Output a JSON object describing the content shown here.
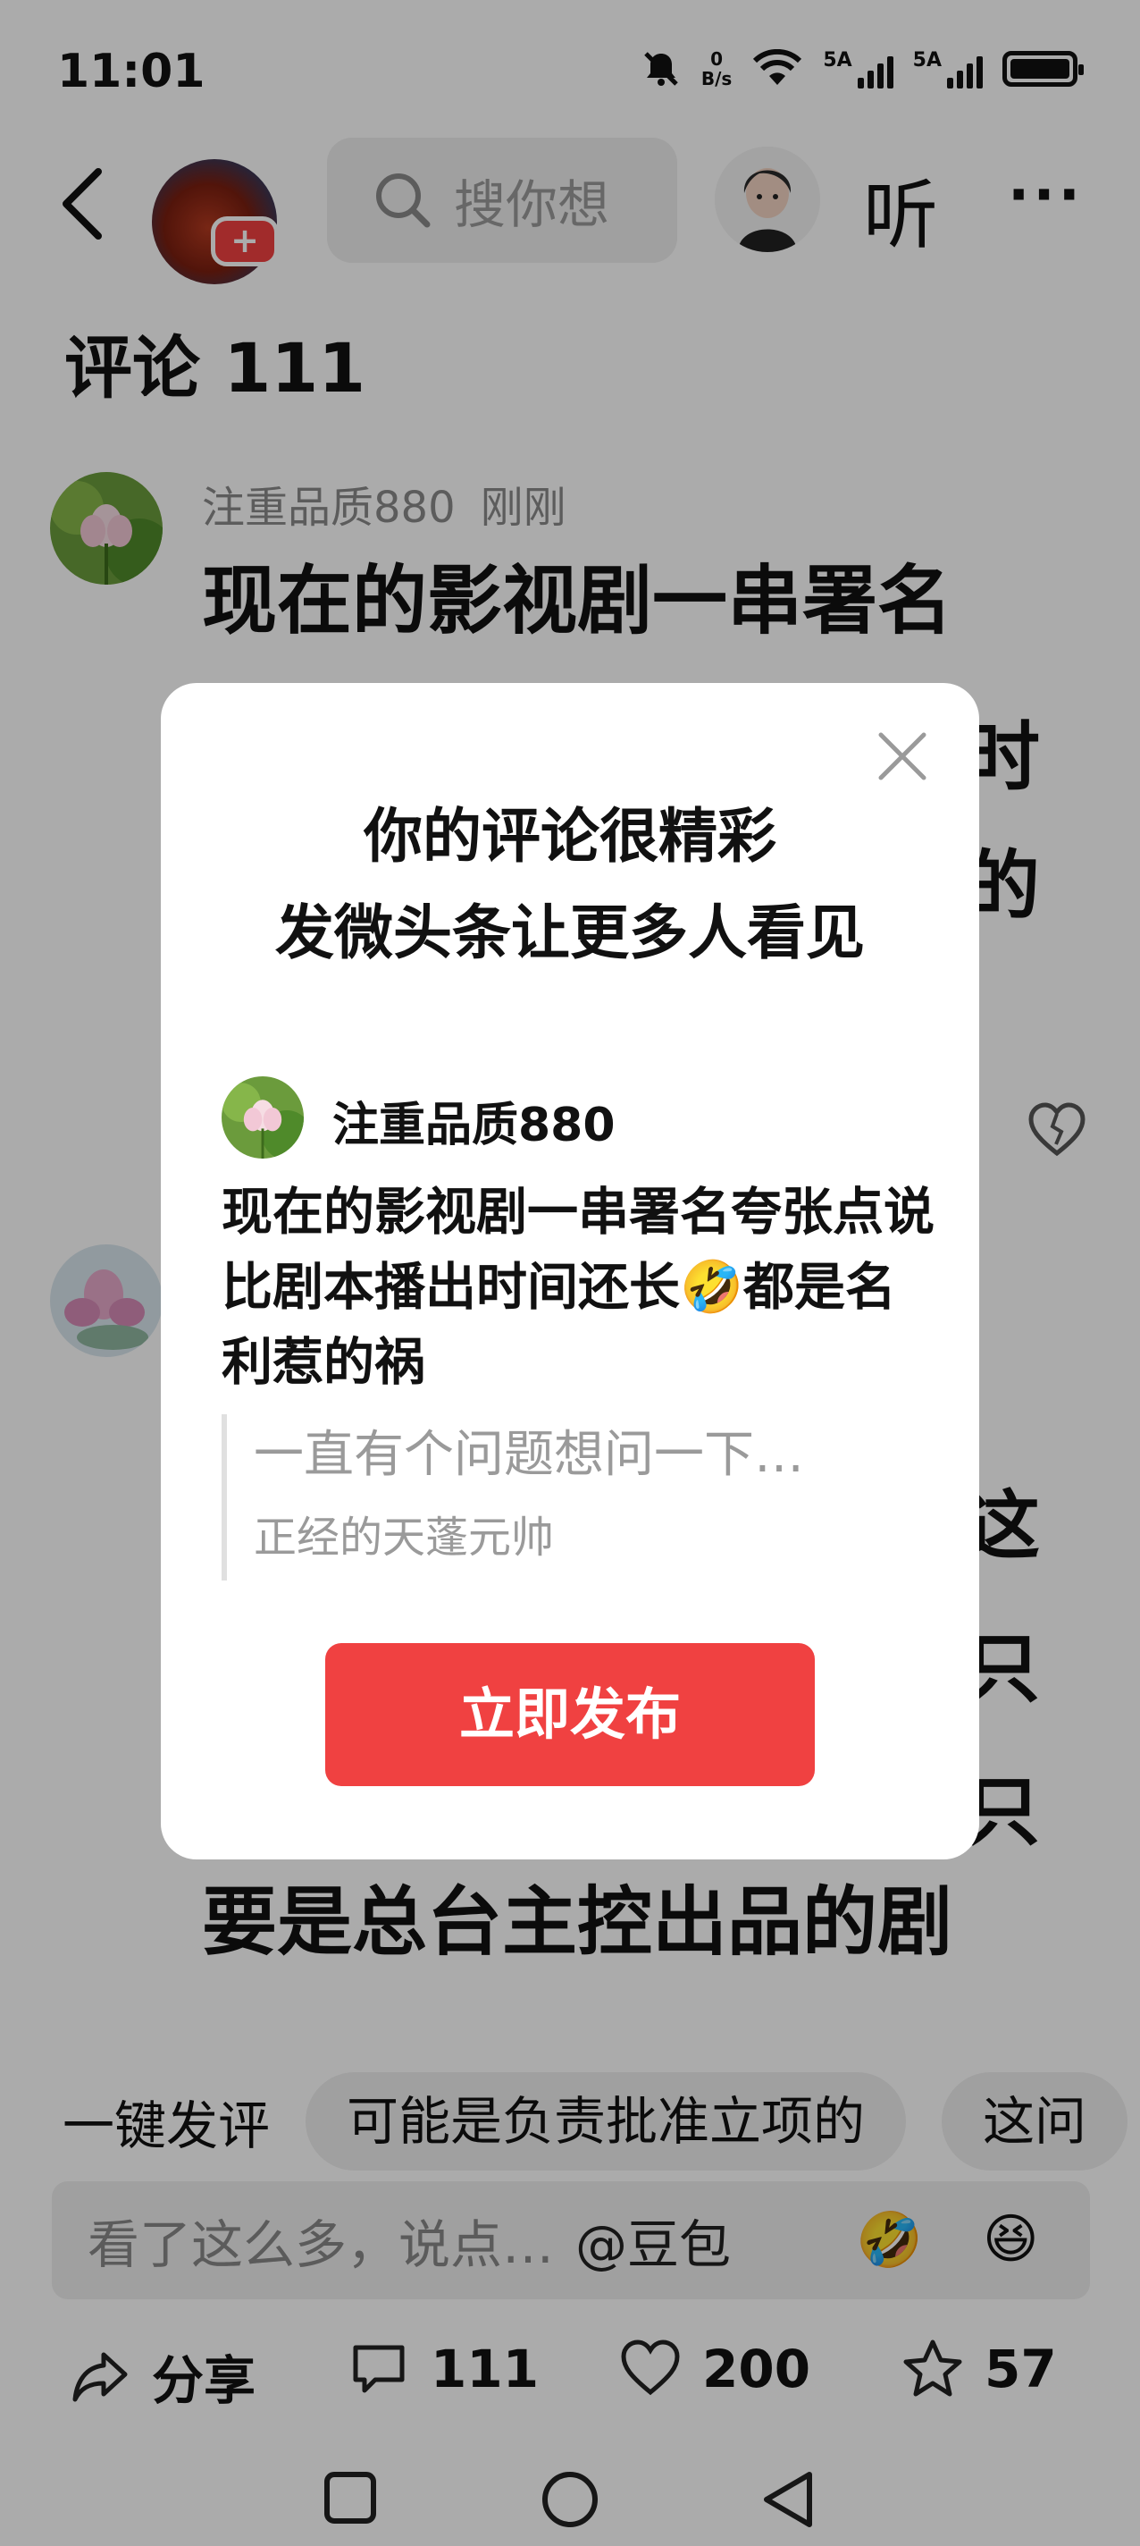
{
  "status_bar": {
    "time": "11:01",
    "net_speed_value": "0",
    "net_speed_unit": "B/s",
    "signal1_label": "5A",
    "signal2_label": "5A"
  },
  "header": {
    "search_placeholder": "搜你想",
    "listen_label": "听",
    "more_label": "···"
  },
  "comments": {
    "title": "评论 111",
    "items": [
      {
        "author": "注重品质880",
        "time": "刚刚",
        "text_lines": [
          "现在的影视剧一串署名",
          "",
          ""
        ]
      },
      {
        "text_lines": [
          "要是总台主控出品的剧"
        ]
      }
    ],
    "partial_glyphs": [
      "时",
      "的",
      "这",
      "只",
      "只"
    ]
  },
  "quick_reply": {
    "label": "一键发评",
    "chips": [
      "可能是负责批准立项的",
      "这问"
    ]
  },
  "composer": {
    "placeholder": "看了这么多，说点…",
    "mention": "@豆包",
    "emoji1": "🤣",
    "emoji2": "😆"
  },
  "actions": {
    "share_label": "分享",
    "comment_count": "111",
    "like_count": "200",
    "favorite_count": "57"
  },
  "dialog": {
    "title_line1": "你的评论很精彩",
    "title_line2": "发微头条让更多人看见",
    "author": "注重品质880",
    "comment_text": "现在的影视剧一串署名夸张点说比剧本播出时间还长🤣都是名利惹的祸",
    "quote_text": "一直有个问题想问一下…",
    "quote_author": "正经的天蓬元帅",
    "publish_button": "立即发布"
  },
  "colors": {
    "accent_red": "#f04141",
    "overlay": "rgba(0,0,0,0.33)"
  }
}
